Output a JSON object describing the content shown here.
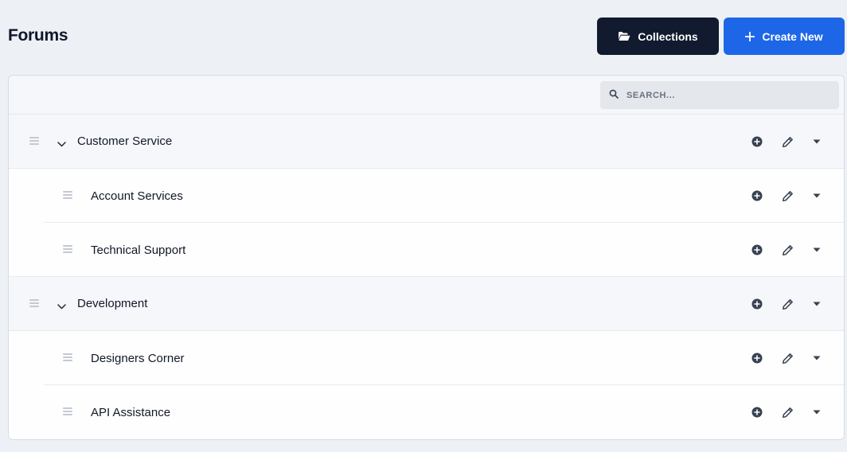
{
  "page": {
    "title": "Forums"
  },
  "toolbar": {
    "collections_label": "Collections",
    "create_label": "Create New",
    "collections_color": "#111a2e",
    "create_color": "#1d66e8"
  },
  "search": {
    "placeholder": "SEARCH...",
    "value": ""
  },
  "forums": [
    {
      "label": "Customer Service",
      "expanded": true,
      "children": [
        {
          "label": "Account Services"
        },
        {
          "label": "Technical Support"
        }
      ]
    },
    {
      "label": "Development",
      "expanded": true,
      "children": [
        {
          "label": "Designers Corner"
        },
        {
          "label": "API Assistance"
        }
      ]
    }
  ],
  "icons": {
    "collections": "folder-open-icon",
    "create": "plus-icon",
    "search": "search-icon",
    "row_add": "plus-circle-icon",
    "row_edit": "pencil-icon",
    "row_menu": "caret-down-icon",
    "drag": "drag-handle-icon",
    "collapse": "chevron-down-icon"
  }
}
